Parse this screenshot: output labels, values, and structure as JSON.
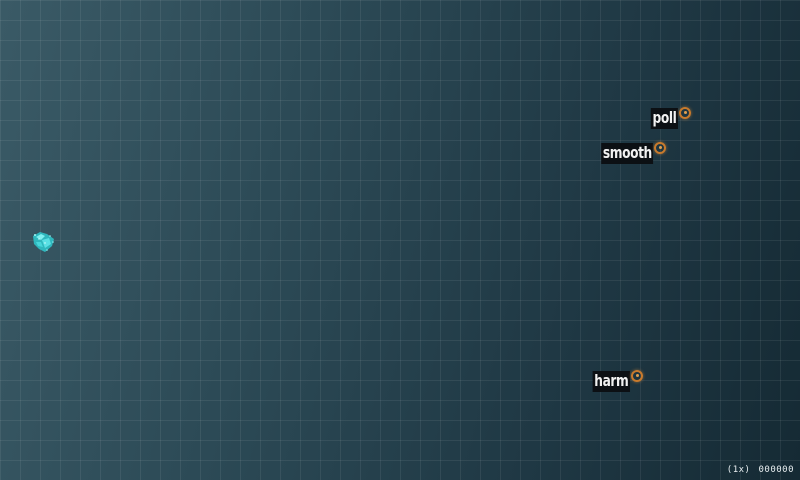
{
  "game": {
    "words": [
      {
        "text": "poll"
      },
      {
        "text": "smooth"
      },
      {
        "text": "harm"
      }
    ],
    "hud": {
      "multiplier": "(1x)",
      "score": "000000"
    },
    "colors": {
      "background": "#2c4a56",
      "label_bg": "#0c1014",
      "label_text": "#f2f2f2",
      "target_ring": "#c87a2c",
      "player": "#3fd4d4"
    },
    "player_icon": "crystal-ship-icon",
    "target_icon": "target-ring-icon"
  }
}
